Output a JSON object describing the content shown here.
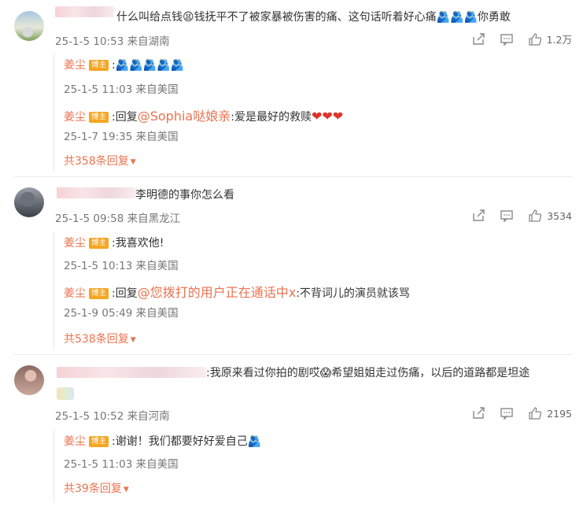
{
  "comments": [
    {
      "text": "什么叫给点钱😫钱抚平不了被家暴被伤害的痛、这句话听着好心痛🫂🫂🫂你勇敢",
      "meta": "25-1-5 10:53 来自湖南",
      "likes": "1.2万",
      "replies": [
        {
          "name": "姜尘",
          "badge": "博主",
          "prefix": ":",
          "mention": "",
          "body": "🫂🫂🫂🫂🫂",
          "meta": "25-1-5 11:03 来自美国"
        },
        {
          "name": "姜尘",
          "badge": "博主",
          "prefix": ":回复",
          "mention": "@Sophia哒娘亲",
          "body": ":爱是最好的救赎",
          "hearts": "❤❤❤",
          "meta": "25-1-7 19:35 来自美国"
        }
      ],
      "more": "共358条回复"
    },
    {
      "text": "李明德的事你怎么看",
      "meta": "25-1-5 09:58 来自黑龙江",
      "likes": "3534",
      "replies": [
        {
          "name": "姜尘",
          "badge": "博主",
          "prefix": ":",
          "mention": "",
          "body": "我喜欢他!",
          "meta": "25-1-5 10:13 来自美国"
        },
        {
          "name": "姜尘",
          "badge": "博主",
          "prefix": ":回复",
          "mention": "@您拨打的用户正在通话中x",
          "body": ":不背词儿的演员就该骂",
          "meta": "25-1-9 05:49 来自美国"
        }
      ],
      "more": "共538条回复"
    },
    {
      "text": ":我原来看过你拍的剧哎😱希望姐姐走过伤痛，以后的道路都是坦途",
      "meta": "25-1-5 10:52 来自河南",
      "likes": "2195",
      "replies": [
        {
          "name": "姜尘",
          "badge": "博主",
          "prefix": ":",
          "mention": "",
          "body": "谢谢！我们都要好好爱自己🫂",
          "meta": "25-1-5 11:03 来自美国"
        }
      ],
      "more": "共39条回复"
    }
  ],
  "icons": {
    "share": "share-icon",
    "comment": "comment-icon",
    "like": "thumbs-up-icon"
  },
  "colors": {
    "accent": "#eb7350",
    "badge": "#f5a623",
    "heart": "#e0332a"
  }
}
